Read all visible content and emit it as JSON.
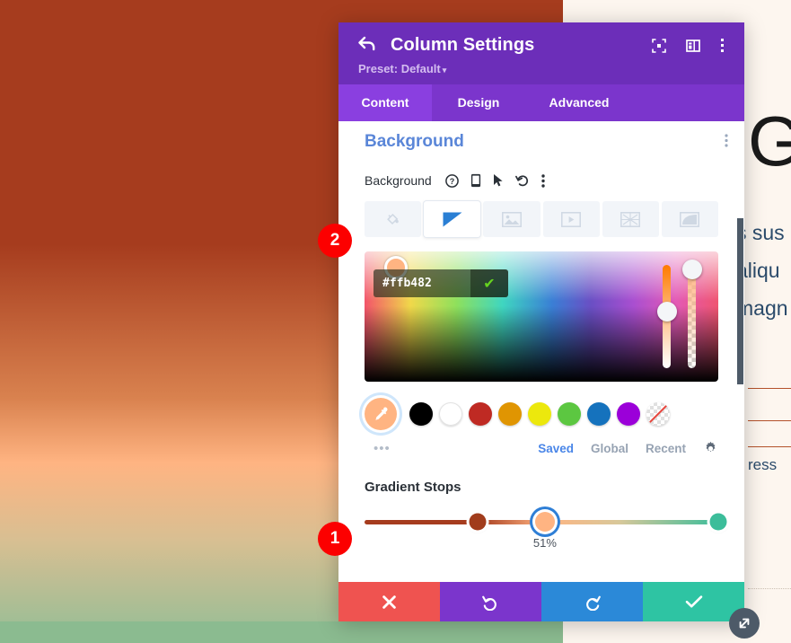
{
  "page": {
    "background_gradient": {
      "from": "#a63c1e",
      "mid": "#ffb482",
      "to": "#93bd96"
    },
    "heading": "G",
    "body_lines": [
      "s sus",
      "aliqu",
      "magn"
    ],
    "small_text": "ress"
  },
  "modal": {
    "title": "Column Settings",
    "back_icon": "back-arrow-icon",
    "preset_label": "Preset: Default",
    "preset_caret": "▾",
    "header_icons": [
      {
        "name": "focus-icon"
      },
      {
        "name": "layout-panel-icon"
      },
      {
        "name": "more-vertical-icon"
      }
    ],
    "tabs": [
      {
        "label": "Content",
        "active": true
      },
      {
        "label": "Design",
        "active": false
      },
      {
        "label": "Advanced",
        "active": false
      }
    ],
    "section": {
      "title": "Background",
      "more_icon": "section-more-icon"
    },
    "field": {
      "label": "Background",
      "icons": [
        {
          "name": "help-icon",
          "glyph": "?"
        },
        {
          "name": "responsive-device-icon"
        },
        {
          "name": "hover-cursor-icon"
        },
        {
          "name": "reset-icon"
        },
        {
          "name": "more-options-icon"
        }
      ]
    },
    "background_types": [
      {
        "name": "bg-type-color",
        "active": false
      },
      {
        "name": "bg-type-gradient",
        "active": true
      },
      {
        "name": "bg-type-image",
        "active": false
      },
      {
        "name": "bg-type-video",
        "active": false
      },
      {
        "name": "bg-type-pattern",
        "active": false
      },
      {
        "name": "bg-type-mask",
        "active": false
      }
    ],
    "color_picker": {
      "hex_value": "#ffb482",
      "hex_placeholder": "#ffffff",
      "confirm_glyph": "✔",
      "hue_handle_percent": 45,
      "alpha_handle_percent": 4
    },
    "swatches": [
      {
        "name": "swatch-eyedropper",
        "color": "#ffb482",
        "selected": true
      },
      {
        "name": "swatch-black",
        "color": "#000000"
      },
      {
        "name": "swatch-white",
        "color": "#ffffff"
      },
      {
        "name": "swatch-dark-red",
        "color": "#bf2a23"
      },
      {
        "name": "swatch-orange",
        "color": "#e09502"
      },
      {
        "name": "swatch-yellow",
        "color": "#ece80d"
      },
      {
        "name": "swatch-green",
        "color": "#5cc741"
      },
      {
        "name": "swatch-blue",
        "color": "#1572bd"
      },
      {
        "name": "swatch-purple",
        "color": "#9b00d9"
      },
      {
        "name": "swatch-transparent",
        "color": "transparent"
      }
    ],
    "palette": {
      "more_glyph": "•••",
      "tabs": [
        {
          "label": "Saved",
          "active": true
        },
        {
          "label": "Global",
          "active": false
        },
        {
          "label": "Recent",
          "active": false
        }
      ],
      "settings_icon": "gear-icon"
    },
    "gradient_stops": {
      "label": "Gradient Stops",
      "selected_value": "51%",
      "stops": [
        {
          "name": "gradient-stop-1",
          "position": 32,
          "color": "#a13c1c",
          "selected": false
        },
        {
          "name": "gradient-stop-2",
          "position": 51,
          "color": "#ffb482",
          "selected": true
        },
        {
          "name": "gradient-stop-3",
          "position": 100,
          "color": "#3cbd9a",
          "selected": false
        }
      ]
    },
    "footer": [
      {
        "name": "cancel-button",
        "glyph": "✕",
        "color": "#ef5350"
      },
      {
        "name": "undo-button",
        "glyph": "↺",
        "color": "#7b35cc"
      },
      {
        "name": "redo-button",
        "glyph": "↻",
        "color": "#2b89d8"
      },
      {
        "name": "save-button",
        "glyph": "✔",
        "color": "#2ec4a3"
      }
    ]
  },
  "annotations": [
    {
      "name": "annotation-badge-2",
      "label": "2"
    },
    {
      "name": "annotation-badge-1",
      "label": "1"
    }
  ],
  "resize_handle": {
    "name": "resize-handle-icon"
  }
}
